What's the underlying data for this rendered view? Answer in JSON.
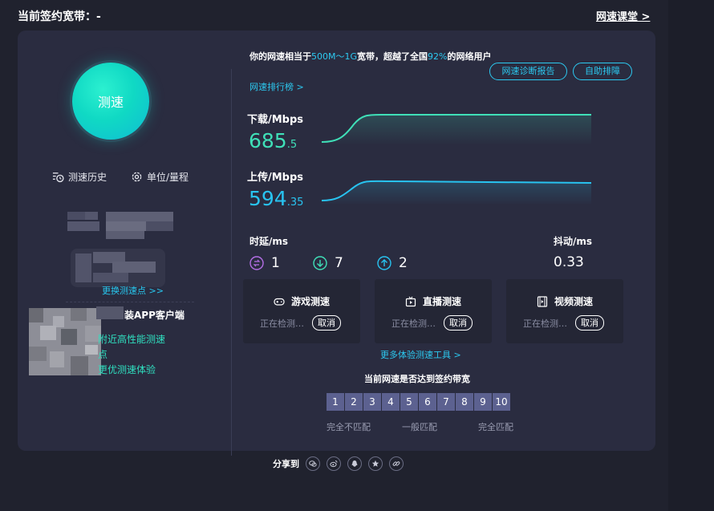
{
  "header": {
    "title": "当前签约宽带：-",
    "right_link": "网速课堂 >"
  },
  "left": {
    "speed_button": "测速",
    "history_label": "测速历史",
    "unit_label": "单位/量程",
    "change_node": "更换测速点 >>",
    "app_title": "装APP客户端",
    "app_line1": "附近高性能测速",
    "app_line2": "点",
    "app_line3": "更优测速体验"
  },
  "summary": {
    "part1": "你的网速相当于",
    "tier": "500M～1G",
    "part2": "宽带，超越了全国",
    "percent": "92%",
    "part3": "的网络用户",
    "rank_link": "网速排行榜 >",
    "report_button": "网速诊断报告",
    "self_fix_button": "自助排障"
  },
  "download": {
    "label": "下载/Mbps",
    "int": "685",
    "dec": ".5",
    "color": "#3fe0b8"
  },
  "upload": {
    "label": "上传/Mbps",
    "int": "594",
    "dec": ".35",
    "color": "#28c3f0"
  },
  "latency": {
    "label": "时延/ms",
    "idle": "1",
    "down": "7",
    "up": "2"
  },
  "jitter": {
    "label": "抖动/ms",
    "value": "0.33"
  },
  "tools": [
    {
      "name": "游戏测速",
      "status": "正在检测…",
      "cancel": "取消",
      "icon": "gamepad-icon"
    },
    {
      "name": "直播测速",
      "status": "正在检测…",
      "cancel": "取消",
      "icon": "tv-icon"
    },
    {
      "name": "视频测速",
      "status": "正在检测…",
      "cancel": "取消",
      "icon": "film-icon"
    }
  ],
  "more_tools": "更多体验测速工具 >",
  "match": {
    "title": "当前网速是否达到签约带宽",
    "scale": [
      "1",
      "2",
      "3",
      "4",
      "5",
      "6",
      "7",
      "8",
      "9",
      "10"
    ],
    "low": "完全不匹配",
    "mid": "一般匹配",
    "high": "完全匹配"
  },
  "share": {
    "label": "分享到"
  }
}
